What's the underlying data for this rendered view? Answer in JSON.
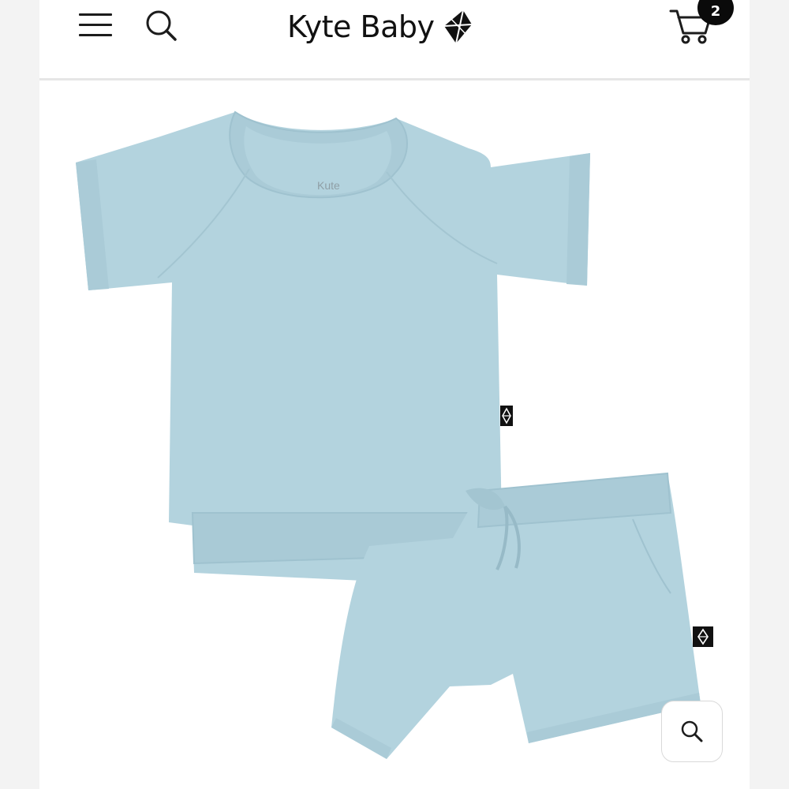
{
  "header": {
    "brand_name": "Kyte Baby",
    "menu_icon": "hamburger-menu-icon",
    "search_icon": "search-icon",
    "brand_logo_icon": "kite-logo-icon",
    "cart_icon": "shopping-cart-icon",
    "cart_count": "2"
  },
  "product": {
    "image_alt": "Light blue short sleeve raglan tee and shorts set",
    "garment_print": "Kute",
    "colors": {
      "garment": "#b3d3de",
      "garment_shadow": "#9fc2cf",
      "tag": "#111111"
    }
  },
  "zoom": {
    "icon": "zoom-magnifier-icon"
  },
  "theme": {
    "background": "#ffffff",
    "outer_background": "#f3f3f3",
    "text": "#111111",
    "badge": "#0a0a0a"
  }
}
